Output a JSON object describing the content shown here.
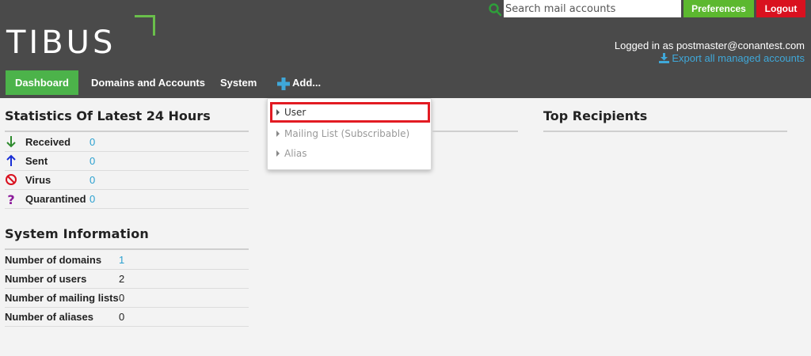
{
  "header": {
    "logo_text": "TIBUS",
    "search_placeholder": "Search mail accounts",
    "preferences_label": "Preferences",
    "logout_label": "Logout",
    "logged_in_text": "Logged in as postmaster@conantest.com",
    "export_label": "Export all managed accounts",
    "colors": {
      "brand_green": "#4cb34a",
      "logout_red": "#d9111f",
      "link_blue": "#2aa0d0"
    }
  },
  "nav": {
    "dashboard": "Dashboard",
    "domains": "Domains and Accounts",
    "system": "System",
    "add": "Add..."
  },
  "add_menu": {
    "items": [
      {
        "label": "User",
        "highlighted": true
      },
      {
        "label": "Mailing List (Subscribable)",
        "highlighted": false
      },
      {
        "label": "Alias",
        "highlighted": false
      }
    ]
  },
  "stats": {
    "title": "Statistics Of Latest 24 Hours",
    "rows": [
      {
        "icon": "arrow-down-icon",
        "label": "Received",
        "value": "0"
      },
      {
        "icon": "arrow-up-icon",
        "label": "Sent",
        "value": "0"
      },
      {
        "icon": "prohibited-icon",
        "label": "Virus",
        "value": "0"
      },
      {
        "icon": "question-icon",
        "label": "Quarantined",
        "value": "0"
      }
    ]
  },
  "system_info": {
    "title": "System Information",
    "rows": [
      {
        "label": "Number of domains",
        "value": "1"
      },
      {
        "label": "Number of users",
        "value": "2"
      },
      {
        "label": "Number of mailing lists",
        "value": "0"
      },
      {
        "label": "Number of aliases",
        "value": "0"
      }
    ]
  },
  "top_recipients": {
    "title": "Top Recipients"
  }
}
